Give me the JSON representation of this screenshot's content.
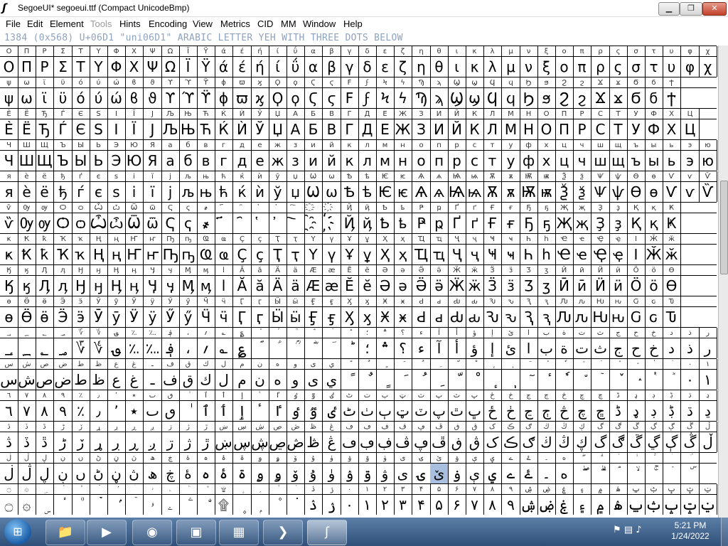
{
  "window": {
    "title": "SegoeUI* segoeui.ttf (Compact UnicodeBmp)",
    "app_icon": "fontforge-icon",
    "controls": [
      "minimize-icon",
      "maximize-icon",
      "close-icon"
    ]
  },
  "menu": [
    {
      "label": "File",
      "enabled": true
    },
    {
      "label": "Edit",
      "enabled": true
    },
    {
      "label": "Element",
      "enabled": true
    },
    {
      "label": "Tools",
      "enabled": false
    },
    {
      "label": "Hints",
      "enabled": true
    },
    {
      "label": "Encoding",
      "enabled": true
    },
    {
      "label": "View",
      "enabled": true
    },
    {
      "label": "Metrics",
      "enabled": true
    },
    {
      "label": "CID",
      "enabled": true
    },
    {
      "label": "MM",
      "enabled": true
    },
    {
      "label": "Window",
      "enabled": true
    },
    {
      "label": "Help",
      "enabled": true
    }
  ],
  "info_line": "1384 (0x568) U+06D1 \"uni06D1\" ARABIC LETTER YEH WITH THREE DOTS BELOW",
  "glyph_rows": [
    "ΟΠΡΣΤΥΦΧΨΩΪΫάέήίΰαβγδεζηθικλμνξοπρςστυφχ",
    "ψωϊϋόύώϐϑϒϓϔϕϖϗϘϙϚϛϜϝϞϟϠϡϢϣϤϥϦϧϨϩϪϫϬϭϮ",
    "ЀЁЂЃЄЅІЇЈЉЊЋЌЍЎЏАБВГДЕЖЗИЙКЛМНОПРСТУФХЦ",
    "ЧШЩЪЫЬЭЮЯабвгдежзийклмнопрстуфхцчшщъыьэю",
    "яѐёђѓєѕіїјљњћќѝўџѠѡѢѣѤѥѦѧѨѩѪѫѬѭѮѯѰѱѲѳѴѵѶ",
    "ѷѸѹѺѻѼѽѾѿҀҁ҂҃҄҅҆҇҈҉ҊҋҌҍҎҏҐґҒғҔҕҖҗҘҙҚқҜ",
    "ҝҞҟҠҡҢңҤҥҦҧҨҩҪҫҬҭҮүҰұҲҳҴҵҶҷҸҹҺһҼҽҾҿӀӁӂ",
    "ӃӄӅӆӇӈӉӊӋӌӍӎӏӐӑӒӓӔӕӖӗӘәӚӛӜӝӞӟӠӡӢӣӤӥӦӧӨ",
    "өӪӫӬӭӮӯӰӱӲӳӴӵӶӷӸӹӺӻӼӽӾӿԀԁԂԃԄԅԆԇԈԉԊԋԌԍԎ",
    "؀؁؂؃؆؇؈؉؊؋،؍؎؏ؐؑؒؓؔؕ؛؞؟ءآأؤإئابةتثجحخدذرز",
    "سشصضطظعغـفقكلمنهوىيًٌٍَُِّْٕٖٓٔٗ٘ٙٚٛٝٞ٠١٢٣٤٥",
    "٦٧٨٩٪٫٬٭ٮٯٰٱٲٳٴٵٶٷٸٹٺٻټٽپٿڀځڂڃڄڅچڇڈډڊڋڌڍ",
    "ڎڏڐڑڒړڔڕږڗژڙښڛڜڝڞڟڠڡڢڣڤڥڦڧڨکڪګڬڭڮگڰڱڲڳڴڵ",
    "ڶڷڸڹںڻڼڽھڿۀہۂۃۄۅۆۇۈۉۊۋیۍێۏېۑےۓ۔ەۖۗۘۙۚۛۜ",
    "۝۞ۣ۟۠ۡۢۤۥۦۧۨ۩۪ۭ۫۬ۮۯ۰۱۲۳۴۵۶۷۸۹ۺۻۼ۽۾ۿݐݑݒݓݔ"
  ],
  "selected_glyph": {
    "row": 13,
    "col": 24
  },
  "taskbar": {
    "apps": [
      {
        "name": "windows-explorer",
        "icon": "folder-icon"
      },
      {
        "name": "media-player",
        "icon": "media-icon"
      },
      {
        "name": "chrome",
        "icon": "chrome-icon"
      },
      {
        "name": "command-prompt",
        "icon": "cmd-icon"
      },
      {
        "name": "control-panel",
        "icon": "control-panel-icon"
      },
      {
        "name": "powershell",
        "icon": "powershell-icon"
      },
      {
        "name": "fontforge",
        "icon": "fontforge-icon",
        "active": true
      }
    ],
    "clock_time": "5:21 PM",
    "clock_date": "1/24/2022"
  }
}
